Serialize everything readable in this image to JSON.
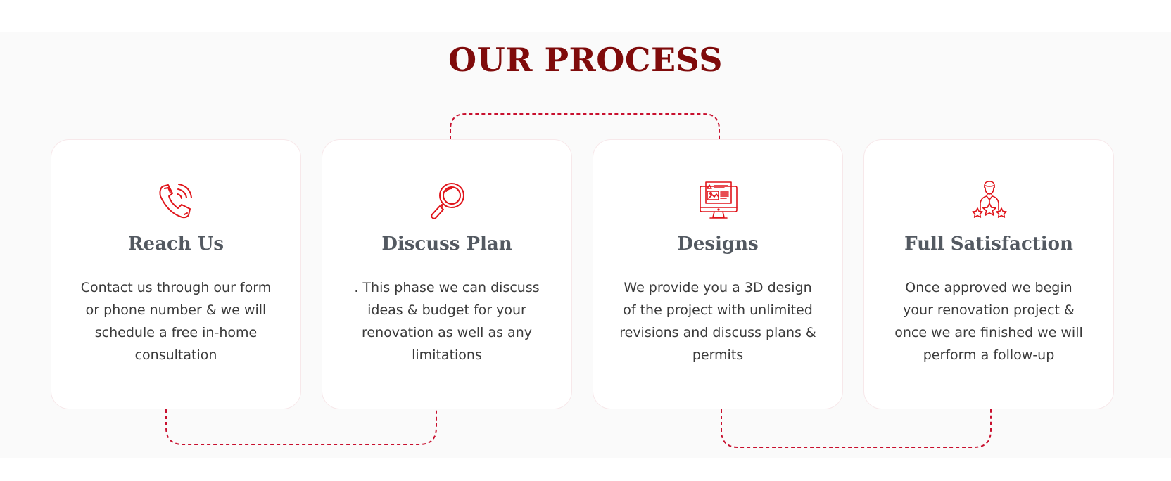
{
  "colors": {
    "title": "#7f0b0b",
    "accent": "#e0141a",
    "connector": "#c8102e",
    "heading": "#535961",
    "text": "#3a3a3a",
    "section_bg": "#fafafa"
  },
  "section": {
    "title": "OUR PROCESS"
  },
  "steps": [
    {
      "icon": "phone-call-icon",
      "title": "Reach Us",
      "text": "Contact us through our form or phone number & we will schedule a free in-home consultation"
    },
    {
      "icon": "magnifying-glass-icon",
      "title": "Discuss Plan",
      "text": ". This phase we can discuss ideas & budget for your renovation as well as any limitations"
    },
    {
      "icon": "computer-design-icon",
      "title": "Designs",
      "text": "We provide you a 3D design of the project with unlimited revisions and discuss plans & permits"
    },
    {
      "icon": "customer-rating-icon",
      "title": "Full Satisfaction",
      "text": "Once approved we begin your renovation project & once we are finished we will perform a follow-up"
    }
  ]
}
